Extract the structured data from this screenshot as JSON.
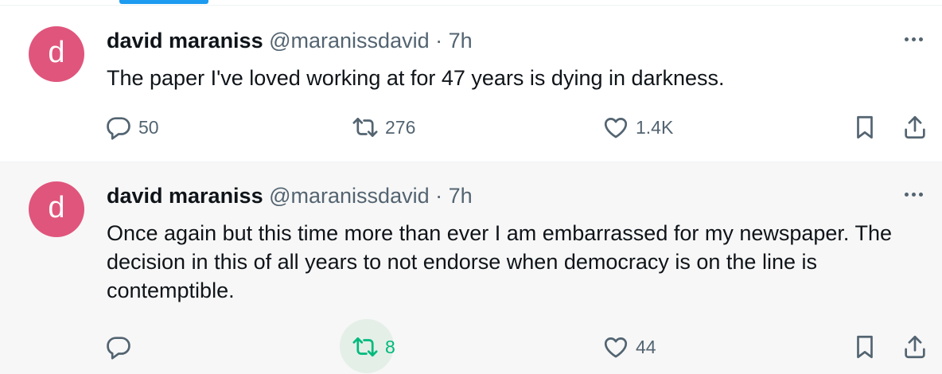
{
  "tweets": [
    {
      "avatar_letter": "d",
      "name": "david maraniss",
      "handle": "@maranissdavid",
      "separator": "·",
      "time": "7h",
      "text": "The paper I've loved working at for 47 years is dying in darkness.",
      "replies": "50",
      "retweets": "276",
      "likes": "1.4K"
    },
    {
      "avatar_letter": "d",
      "name": "david maraniss",
      "handle": "@maranissdavid",
      "separator": "·",
      "time": "7h",
      "text": "Once again but this time more than ever I am embarrassed for my newspaper. The decision in this of all years to not endorse when democracy is on the line is contemptible.",
      "replies": "",
      "retweets": "8",
      "likes": "44",
      "retweeted": true
    }
  ],
  "colors": {
    "accent": "#1d9bf0",
    "avatar_bg": "#e0557c",
    "muted_text": "#536471",
    "retweet_green": "#00ba7c"
  },
  "icons": [
    "reply-icon",
    "retweet-icon",
    "like-icon",
    "bookmark-icon",
    "share-icon",
    "more-options-icon"
  ]
}
